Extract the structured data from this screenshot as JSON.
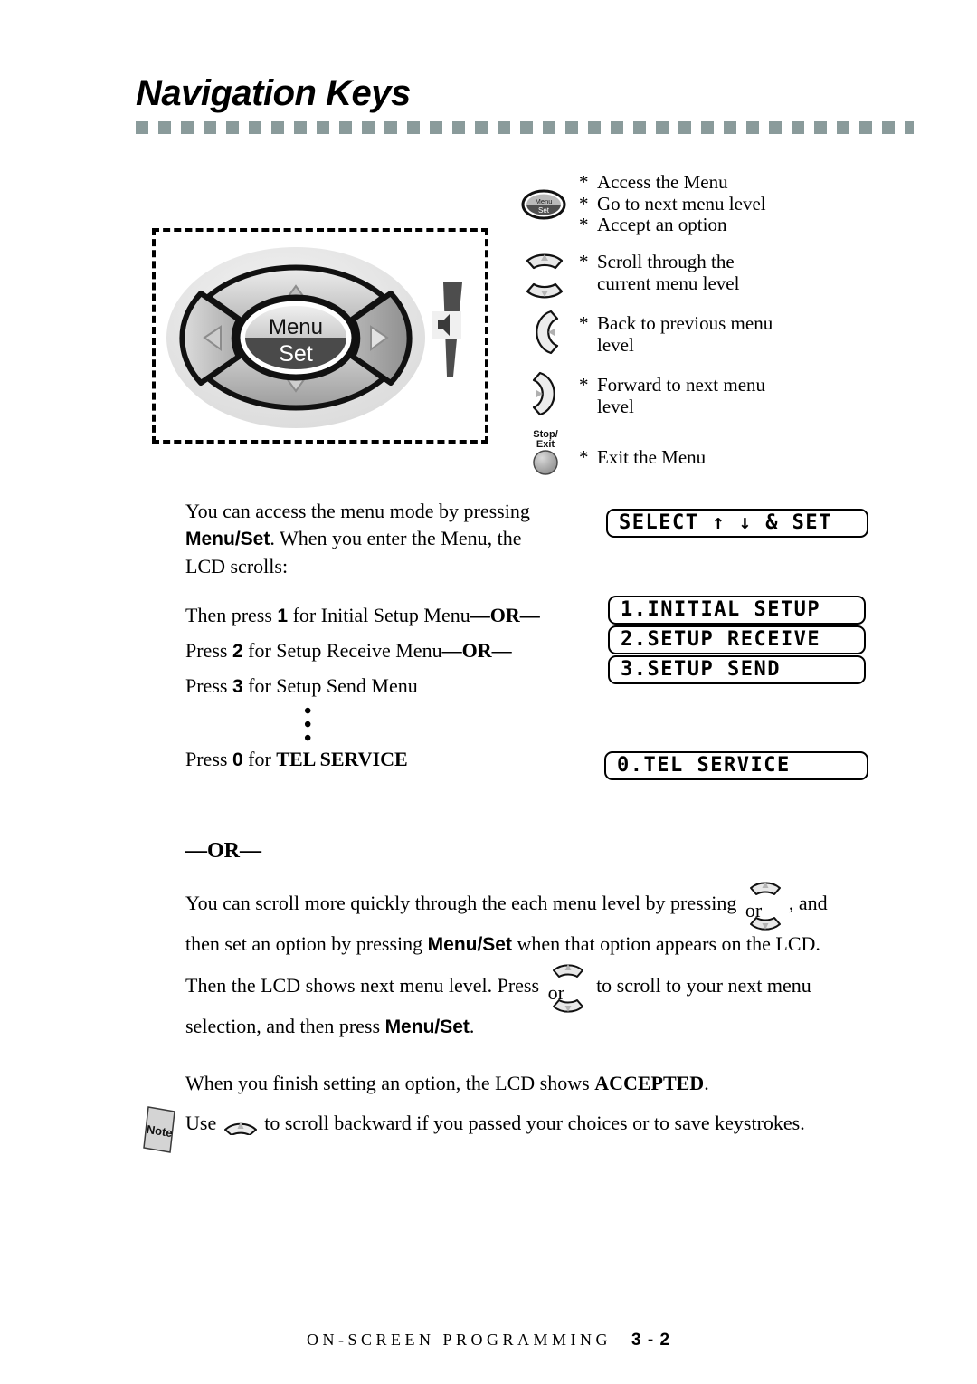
{
  "title": "Navigation Keys",
  "accent_color": "#8a9b9b",
  "keypad": {
    "center_top_label": "Menu",
    "center_bottom_label": "Set",
    "up_key": "up-arrow",
    "down_key": "down-arrow",
    "left_key": "left-arrow",
    "right_key": "right-arrow",
    "speaker_icon": "speaker-volume-icon"
  },
  "legend": [
    {
      "icon": "menu-set-key",
      "icon_label_top": "Menu",
      "icon_label_bottom": "Set",
      "lines": [
        "Access the Menu",
        "Go to next menu level",
        "Accept an option"
      ],
      "bullet": "*"
    },
    {
      "icon": "up-down-scroll-keys",
      "lines": [
        "Scroll through the",
        "current menu level"
      ],
      "bullet": "*"
    },
    {
      "icon": "left-arrow-key",
      "lines": [
        "Back to previous menu",
        "level"
      ],
      "bullet": "*"
    },
    {
      "icon": "right-arrow-key",
      "lines": [
        "Forward to next menu",
        "level"
      ],
      "bullet": "*"
    },
    {
      "icon": "stop-exit-key",
      "icon_label_top": "Stop/",
      "icon_label_bottom": "Exit",
      "lines": [
        "Exit the Menu"
      ],
      "bullet": "*"
    }
  ],
  "paragraphs": {
    "intro_1": "You can access the menu mode by pressing ",
    "intro_menuset": "Menu/Set",
    "intro_2": ". When you enter the Menu, the",
    "intro_3": "LCD scrolls:",
    "step1_a": "Then press ",
    "step1_num": "1",
    "step1_b": " for Initial Setup Menu",
    "step1_or": "—OR—",
    "step2_a": "Press ",
    "step2_num": "2",
    "step2_b": " for Setup Receive Menu",
    "step2_or": "—OR—",
    "step3_a": "Press ",
    "step3_num": "3",
    "step3_b": " for Setup Send Menu",
    "step0_a": "Press ",
    "step0_num": "0",
    "step0_b": " for ",
    "step0_bold": "TEL SERVICE",
    "or_divider": "—OR—",
    "scroll_1a": "You can scroll more quickly through the each menu level by pressing ",
    "scroll_or": "or",
    "scroll_1b": ", and",
    "scroll_2a": "then set an option by pressing ",
    "scroll_2_menuset": "Menu/Set",
    "scroll_2b": " when that option appears on the LCD.",
    "scroll_3a": "Then the LCD shows next menu level. Press ",
    "scroll_3b": " to scroll to your next menu",
    "scroll_4a": "selection, and then press ",
    "scroll_4_menuset": "Menu/Set",
    "scroll_4b": ".",
    "accepted_a": "When you finish setting an option, the LCD shows ",
    "accepted_bold": "ACCEPTED",
    "accepted_b": ".",
    "note_a": "Use ",
    "note_b": " to scroll backward if you passed your choices or to save keystrokes."
  },
  "note_icon_label": "Note",
  "lcd_displays": [
    {
      "name": "select-set",
      "text": "SELECT ↑ ↓ & SET"
    },
    {
      "name": "initial-setup",
      "text": "1.INITIAL SETUP"
    },
    {
      "name": "setup-receive",
      "text": "2.SETUP RECEIVE"
    },
    {
      "name": "setup-send",
      "text": "3.SETUP SEND"
    },
    {
      "name": "tel-service",
      "text": "0.TEL SERVICE"
    }
  ],
  "vertical_dots": "•",
  "footer": {
    "label": "ON-SCREEN PROGRAMMING",
    "page": "3 - 2"
  }
}
